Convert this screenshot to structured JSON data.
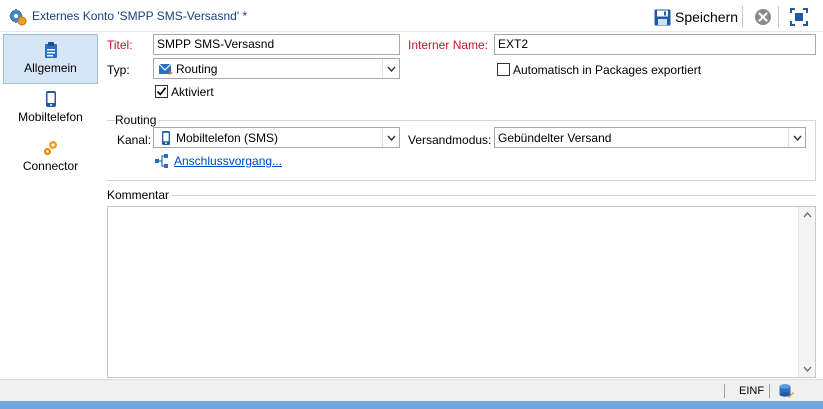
{
  "window": {
    "title": "Externes Konto 'SMPP SMS-Versasnd' *",
    "save_label": "Speichern"
  },
  "sidebar": {
    "items": [
      {
        "label": "Allgemein",
        "icon": "clipboard-icon",
        "active": true
      },
      {
        "label": "Mobiltelefon",
        "icon": "mobile-phone-icon",
        "active": false
      },
      {
        "label": "Connector",
        "icon": "gears-icon",
        "active": false
      }
    ]
  },
  "form": {
    "title_label": "Titel:",
    "title_value": "SMPP SMS-Versasnd",
    "internal_name_label": "Interner Name:",
    "internal_name_value": "EXT2",
    "type_label": "Typ:",
    "type_value": "Routing",
    "auto_export_label": "Automatisch in Packages exportiert",
    "auto_export_checked": false,
    "enabled_label": "Aktiviert",
    "enabled_checked": true
  },
  "routing": {
    "group_title": "Routing",
    "channel_label": "Kanal:",
    "channel_value": "Mobiltelefon (SMS)",
    "delivery_mode_label": "Versandmodus:",
    "delivery_mode_value": "Gebündelter Versand",
    "connection_link": "Anschlussvorgang..."
  },
  "comment": {
    "group_title": "Kommentar",
    "value": ""
  },
  "statusbar": {
    "insert_mode": "EINF"
  },
  "colors": {
    "required_label": "#c8102e",
    "title_text": "#1a3f80",
    "link": "#0046c8",
    "active_nav_bg": "#d6e6f6",
    "bottom_strip": "#6fa6dc"
  }
}
